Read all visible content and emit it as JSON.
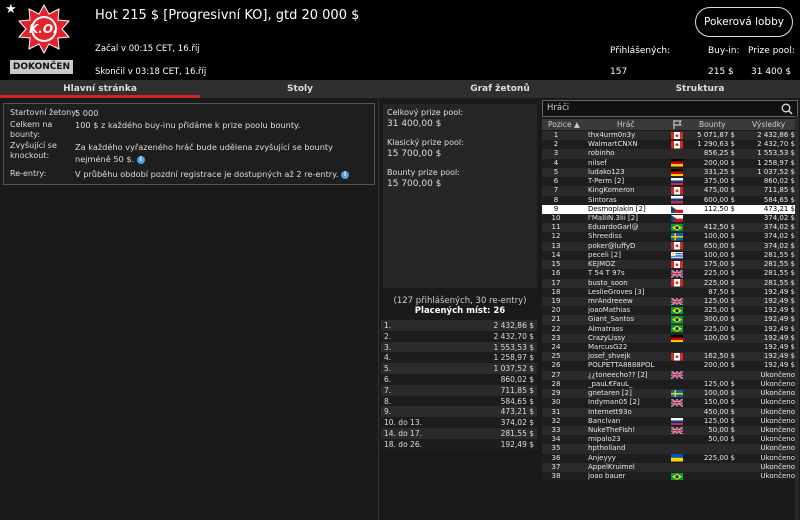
{
  "header": {
    "title": "Hot 215 $ [Progresivní KO], gtd 20 000 $",
    "logo_text": "K.O.",
    "status": "DOKONČEN",
    "started": "Začal v 00:15 CET, 16.říj",
    "ended": "Skončil v 03:18 CET, 16.říj",
    "stats": [
      {
        "label": "Přihlášených:",
        "value": "157"
      },
      {
        "label": "Buy-in:",
        "value": "215 $"
      },
      {
        "label": "Prize pool:",
        "value": "31 400 $"
      }
    ],
    "lobby_button": "Pokerová lobby"
  },
  "tabs": [
    "Hlavní stránka",
    "Stoly",
    "Graf žetonů",
    "Struktura"
  ],
  "info": {
    "chips_label": "Startovní žetony:",
    "chips_value": "5 000",
    "bounty_label": "Celkem na bounty:",
    "bounty_value": "100 $ z každého buy-inu přidáme k prize poolu bounty.",
    "increase_label": "Zvyšující se knockout:",
    "increase_value": "Za každého vyřazeného hráč bude udělena zvyšující se bounty nejméně 50 $.",
    "reentry_label": "Re-entry:",
    "reentry_value": "V průběhu období pozdní registrace je dostupných až 2 re-entry."
  },
  "pools": {
    "total_label": "Celkový prize pool:",
    "total_value": "31 400,00 $",
    "classic_label": "Klasický prize pool:",
    "classic_value": "15 700,00 $",
    "bounty_label": "Bounty prize pool:",
    "bounty_value": "15 700,00 $"
  },
  "registrations": "(127 přihlášených, 30 re-entry)",
  "paid_places": "Placených míst: 26",
  "payouts": [
    [
      "1.",
      "2 432,86 $"
    ],
    [
      "2.",
      "2 432,70 $"
    ],
    [
      "3.",
      "1 553,53 $"
    ],
    [
      "4.",
      "1 258,97 $"
    ],
    [
      "5.",
      "1 037,52 $"
    ],
    [
      "6.",
      "860,02 $"
    ],
    [
      "7.",
      "711,85 $"
    ],
    [
      "8.",
      "584,65 $"
    ],
    [
      "9.",
      "473,21 $"
    ],
    [
      "10. do 13.",
      "374,02 $"
    ],
    [
      "14. do 17.",
      "281,55 $"
    ],
    [
      "18. do 26.",
      "192,49 $"
    ]
  ],
  "players_header": {
    "search_placeholder": "Hráči",
    "col_pos": "Pozice ▲",
    "col_player": "Hráč",
    "col_bounty": "Bounty",
    "col_result": "Výsledky"
  },
  "players": [
    {
      "pos": "1",
      "name": "thx4urm0n3y",
      "flag": "ca",
      "bounty": "5 071,87 $",
      "result": "2 432,86 $"
    },
    {
      "pos": "2",
      "name": "WalmartCNXN",
      "flag": "ca",
      "bounty": "1 290,63 $",
      "result": "2 432,70 $"
    },
    {
      "pos": "3",
      "name": "robinho",
      "flag": "",
      "bounty": "856,25 $",
      "result": "1 553,53 $"
    },
    {
      "pos": "4",
      "name": "nilsef",
      "flag": "de",
      "bounty": "200,00 $",
      "result": "1 258,97 $"
    },
    {
      "pos": "5",
      "name": "ludako123",
      "flag": "de",
      "bounty": "331,25 $",
      "result": "1 037,52 $"
    },
    {
      "pos": "6",
      "name": "T-Perm [2]",
      "flag": "ru",
      "bounty": "375,00 $",
      "result": "860,02 $"
    },
    {
      "pos": "7",
      "name": "KingKomeron",
      "flag": "ca",
      "bounty": "475,00 $",
      "result": "711,85 $"
    },
    {
      "pos": "8",
      "name": "Sintoras",
      "flag": "ru",
      "bounty": "600,00 $",
      "result": "584,65 $"
    },
    {
      "pos": "9",
      "name": "Desmoplakin [2]",
      "flag": "cz",
      "bounty": "112,50 $",
      "result": "473,21 $"
    },
    {
      "pos": "10",
      "name": "l'MalliN.3lii [2]",
      "flag": "cz",
      "bounty": "",
      "result": "374,02 $"
    },
    {
      "pos": "11",
      "name": "EduardoGarl@",
      "flag": "br",
      "bounty": "412,50 $",
      "result": "374,02 $"
    },
    {
      "pos": "12",
      "name": "Shreediss",
      "flag": "se",
      "bounty": "100,00 $",
      "result": "374,02 $"
    },
    {
      "pos": "13",
      "name": "poker@luffyD",
      "flag": "ca",
      "bounty": "650,00 $",
      "result": "374,02 $"
    },
    {
      "pos": "14",
      "name": "peceli [2]",
      "flag": "uy",
      "bounty": "100,00 $",
      "result": "281,55 $"
    },
    {
      "pos": "15",
      "name": "KEJMOZ",
      "flag": "ca",
      "bounty": "175,00 $",
      "result": "281,55 $"
    },
    {
      "pos": "16",
      "name": "T 54 T 97s",
      "flag": "gb",
      "bounty": "225,00 $",
      "result": "281,55 $"
    },
    {
      "pos": "17",
      "name": "busto_soon",
      "flag": "ca",
      "bounty": "225,00 $",
      "result": "281,55 $"
    },
    {
      "pos": "18",
      "name": "LeslieGroves [3]",
      "flag": "",
      "bounty": "87,50 $",
      "result": "192,49 $"
    },
    {
      "pos": "19",
      "name": "mrAndreeew",
      "flag": "gb",
      "bounty": "125,00 $",
      "result": "192,49 $"
    },
    {
      "pos": "20",
      "name": "joaoMathias",
      "flag": "br",
      "bounty": "325,00 $",
      "result": "192,49 $"
    },
    {
      "pos": "21",
      "name": "Giant_Santos",
      "flag": "br",
      "bounty": "300,00 $",
      "result": "192,49 $"
    },
    {
      "pos": "22",
      "name": "Almatrass",
      "flag": "br",
      "bounty": "225,00 $",
      "result": "192,49 $"
    },
    {
      "pos": "23",
      "name": "CrazyLissy",
      "flag": "de",
      "bounty": "100,00 $",
      "result": "192,49 $"
    },
    {
      "pos": "24",
      "name": "MarcusG22",
      "flag": "",
      "bounty": "",
      "result": "192,49 $"
    },
    {
      "pos": "25",
      "name": "josef_shvejk",
      "flag": "ca",
      "bounty": "162,50 $",
      "result": "192,49 $"
    },
    {
      "pos": "26",
      "name": "POLPETTA8888POL",
      "flag": "",
      "bounty": "200,00 $",
      "result": "192,49 $"
    },
    {
      "pos": "27",
      "name": "¿¿toneecho?? [2]",
      "flag": "gb",
      "bounty": "",
      "result": "Ukončeno"
    },
    {
      "pos": "28",
      "name": "_pauL€FauL_",
      "flag": "",
      "bounty": "125,00 $",
      "result": "Ukončeno"
    },
    {
      "pos": "29",
      "name": "gnetaren [2]",
      "flag": "se",
      "bounty": "100,00 $",
      "result": "Ukončeno"
    },
    {
      "pos": "30",
      "name": "Indyman05 [2]",
      "flag": "gb",
      "bounty": "150,00 $",
      "result": "Ukončeno"
    },
    {
      "pos": "31",
      "name": "Internett93o",
      "flag": "",
      "bounty": "450,00 $",
      "result": "Ukončeno"
    },
    {
      "pos": "32",
      "name": "Banclvan",
      "flag": "ru",
      "bounty": "125,00 $",
      "result": "Ukončeno"
    },
    {
      "pos": "33",
      "name": "NukeTheFish!",
      "flag": "gb",
      "bounty": "50,00 $",
      "result": "Ukončeno"
    },
    {
      "pos": "34",
      "name": "mipalo23",
      "flag": "",
      "bounty": "50,00 $",
      "result": "Ukončeno"
    },
    {
      "pos": "35",
      "name": "hptholland",
      "flag": "",
      "bounty": "",
      "result": "Ukončeno"
    },
    {
      "pos": "36",
      "name": "Anjeyyy",
      "flag": "ua",
      "bounty": "225,00 $",
      "result": "Ukončeno"
    },
    {
      "pos": "37",
      "name": "AppelKruimel",
      "flag": "",
      "bounty": "",
      "result": "Ukončeno"
    },
    {
      "pos": "38",
      "name": "joao bauer",
      "flag": "br",
      "bounty": "",
      "result": "Ukončeno"
    }
  ],
  "colors": {
    "accent": "#d4202a",
    "highlight_row": "#ffffff",
    "info_icon": "#4fa2e0"
  }
}
